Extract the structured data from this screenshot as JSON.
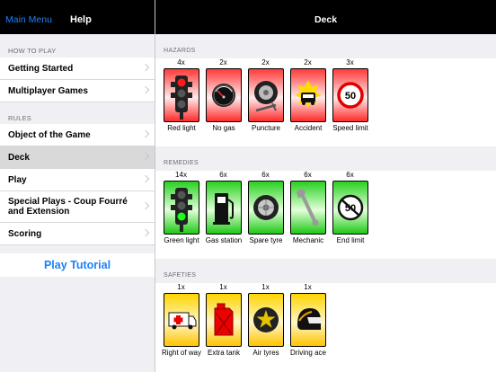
{
  "sidebar": {
    "main_menu": "Main Menu",
    "title": "Help",
    "sections": [
      {
        "header": "HOW TO PLAY",
        "items": [
          "Getting Started",
          "Multiplayer Games"
        ]
      },
      {
        "header": "RULES",
        "items": [
          "Object of the Game",
          "Deck",
          "Play",
          "Special Plays - Coup Fourré and Extension",
          "Scoring"
        ]
      }
    ],
    "selected": "Deck",
    "tutorial": "Play Tutorial"
  },
  "main": {
    "title": "Deck",
    "hazards": {
      "header": "HAZARDS",
      "cards": [
        {
          "count": "4x",
          "name": "Red light",
          "icon": "traffic-light-red-icon"
        },
        {
          "count": "2x",
          "name": "No gas",
          "icon": "fuel-gauge-empty-icon"
        },
        {
          "count": "2x",
          "name": "Puncture",
          "icon": "punctured-tyre-icon"
        },
        {
          "count": "2x",
          "name": "Accident",
          "icon": "car-crash-icon"
        },
        {
          "count": "3x",
          "name": "Speed limit",
          "icon": "speed-limit-50-icon"
        }
      ]
    },
    "remedies": {
      "header": "REMEDIES",
      "cards": [
        {
          "count": "14x",
          "name": "Green light",
          "icon": "traffic-light-green-icon"
        },
        {
          "count": "6x",
          "name": "Gas station",
          "icon": "fuel-pump-icon"
        },
        {
          "count": "6x",
          "name": "Spare tyre",
          "icon": "spare-tyre-icon"
        },
        {
          "count": "6x",
          "name": "Mechanic",
          "icon": "wrench-icon"
        },
        {
          "count": "6x",
          "name": "End limit",
          "icon": "end-speed-limit-icon"
        }
      ]
    },
    "safeties": {
      "header": "SAFETIES",
      "cards": [
        {
          "count": "1x",
          "name": "Right of way",
          "icon": "ambulance-icon"
        },
        {
          "count": "1x",
          "name": "Extra tank",
          "icon": "jerry-can-icon"
        },
        {
          "count": "1x",
          "name": "Air tyres",
          "icon": "star-tyre-icon"
        },
        {
          "count": "1x",
          "name": "Driving ace",
          "icon": "racing-helmet-icon"
        }
      ]
    }
  }
}
